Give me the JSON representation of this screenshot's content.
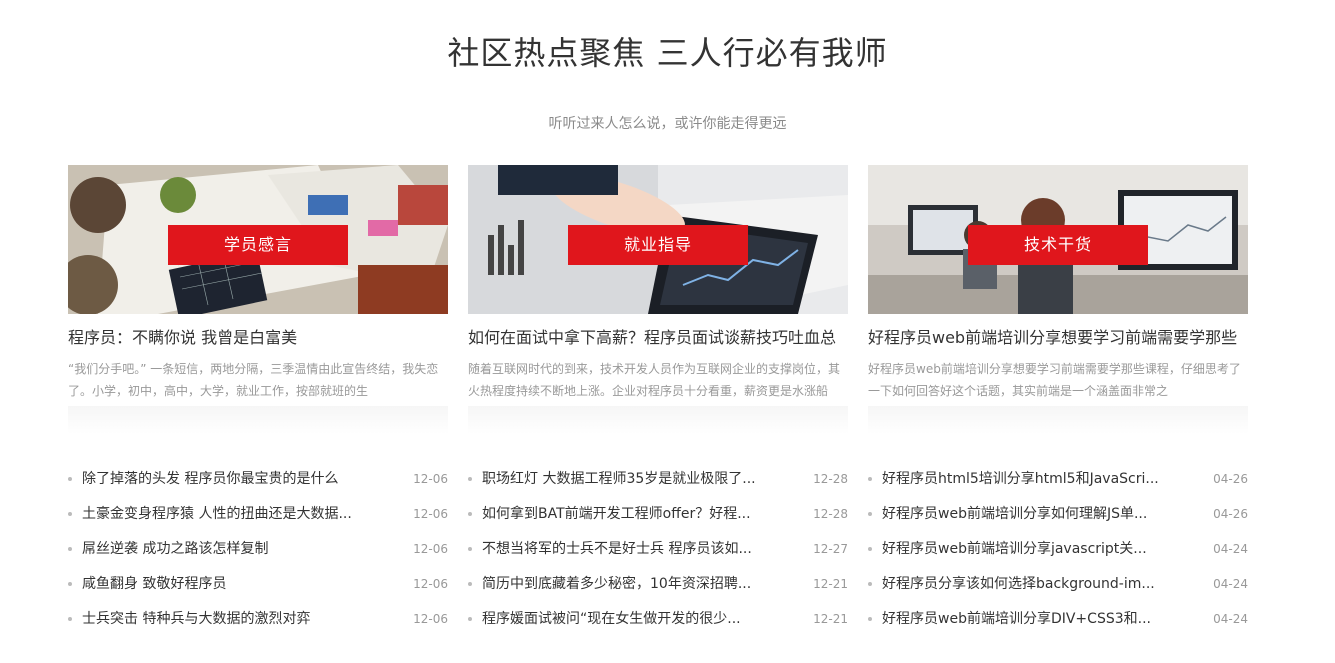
{
  "header": {
    "title": "社区热点聚焦 三人行必有我师",
    "subtitle": "听听过来人怎么说，或许你能走得更远"
  },
  "columns": [
    {
      "tag": "学员感言",
      "title": "程序员：不瞒你说 我曾是白富美",
      "summary": "“我们分手吧。” 一条短信，两地分隔，三季温情由此宣告终结，我失恋了。小学，初中，高中，大学，就业工作，按部就班的生",
      "items": [
        {
          "title": "除了掉落的头发 程序员你最宝贵的是什么",
          "date": "12-06"
        },
        {
          "title": "土豪金变身程序猿 人性的扭曲还是大数据...",
          "date": "12-06"
        },
        {
          "title": "屌丝逆袭 成功之路该怎样复制",
          "date": "12-06"
        },
        {
          "title": "咸鱼翻身 致敬好程序员",
          "date": "12-06"
        },
        {
          "title": "士兵突击 特种兵与大数据的激烈对弈",
          "date": "12-06"
        }
      ]
    },
    {
      "tag": "就业指导",
      "title": "如何在面试中拿下高薪？程序员面试谈薪技巧吐血总",
      "summary": "随着互联网时代的到来，技术开发人员作为互联网企业的支撑岗位，其火热程度持续不断地上涨。企业对程序员十分看重，薪资更是水涨船",
      "items": [
        {
          "title": "职场红灯 大数据工程师35岁是就业极限了...",
          "date": "12-28"
        },
        {
          "title": "如何拿到BAT前端开发工程师offer？好程...",
          "date": "12-28"
        },
        {
          "title": "不想当将军的士兵不是好士兵 程序员该如...",
          "date": "12-27"
        },
        {
          "title": "简历中到底藏着多少秘密，10年资深招聘...",
          "date": "12-21"
        },
        {
          "title": "程序媛面试被问“现在女生做开发的很少...",
          "date": "12-21"
        }
      ]
    },
    {
      "tag": "技术干货",
      "title": "好程序员web前端培训分享想要学习前端需要学那些",
      "summary": "好程序员web前端培训分享想要学习前端需要学那些课程，仔细思考了一下如何回答好这个话题，其实前端是一个涵盖面非常之",
      "items": [
        {
          "title": "好程序员html5培训分享html5和JavaScri...",
          "date": "04-26"
        },
        {
          "title": "好程序员web前端培训分享如何理解JS单...",
          "date": "04-26"
        },
        {
          "title": "好程序员web前端培训分享javascript关...",
          "date": "04-24"
        },
        {
          "title": "好程序员分享该如何选择background-im...",
          "date": "04-24"
        },
        {
          "title": "好程序员web前端培训分享DIV+CSS3和...",
          "date": "04-24"
        }
      ]
    }
  ],
  "colors": {
    "accent": "#e0161c",
    "text": "#333333",
    "muted": "#999999"
  }
}
